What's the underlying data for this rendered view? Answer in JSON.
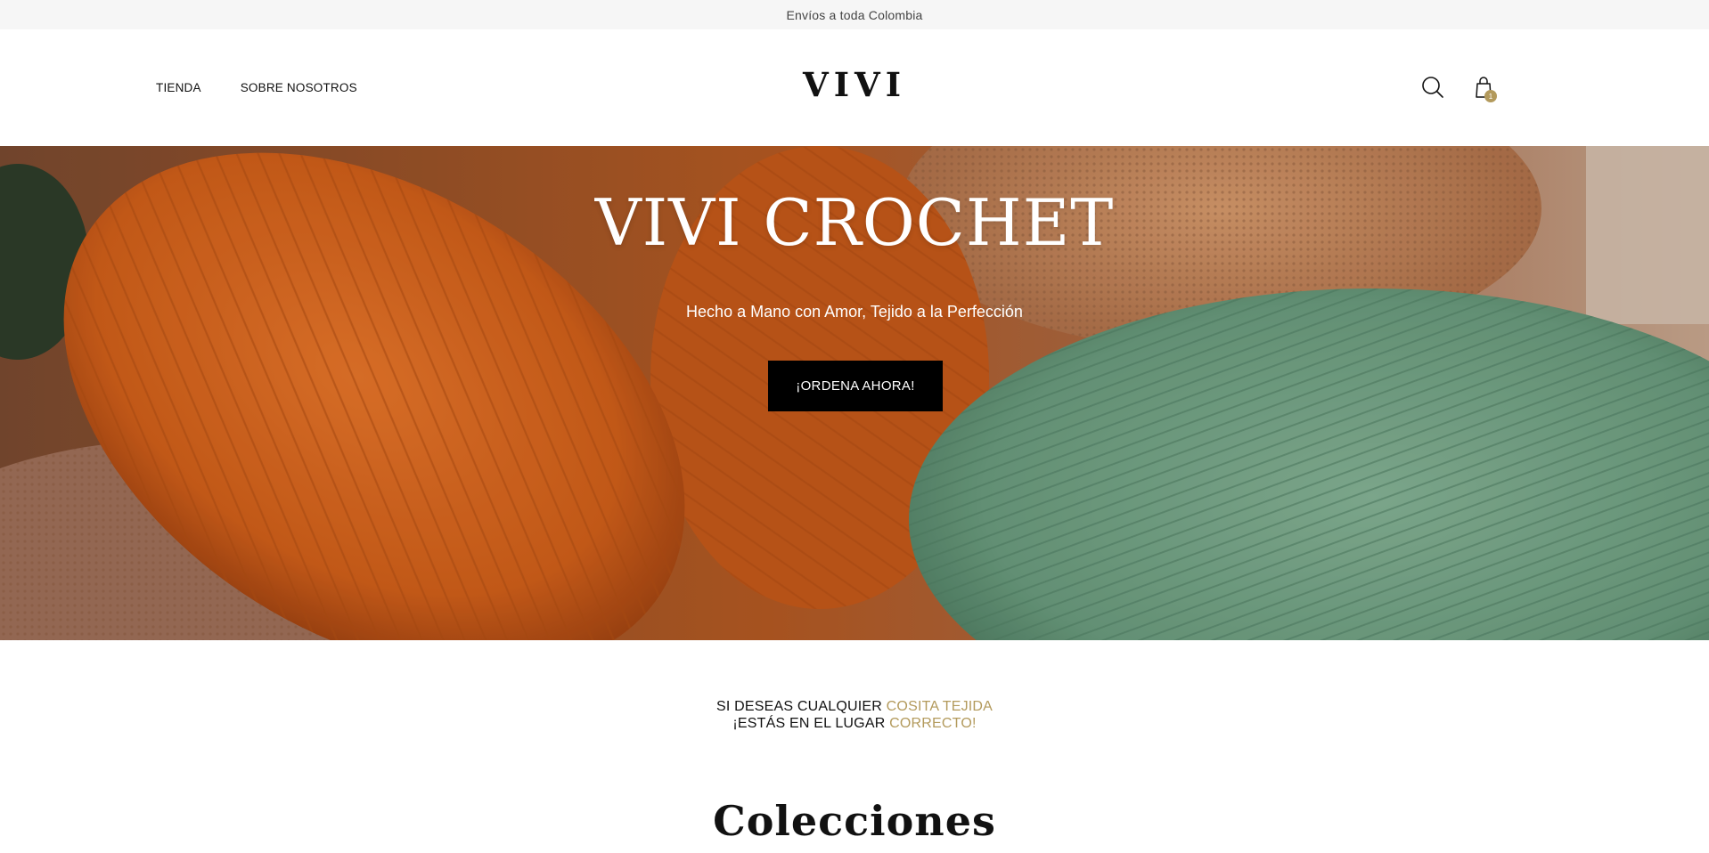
{
  "announcement": {
    "text": "Envíos a toda Colombia"
  },
  "header": {
    "nav": [
      {
        "label": "TIENDA"
      },
      {
        "label": "SOBRE NOSOTROS"
      }
    ],
    "logo": "VIVI",
    "icons": {
      "search": "search-icon",
      "cart": "shopping-bag-icon"
    },
    "cart_count": "1"
  },
  "hero": {
    "title": "VIVI CROCHET",
    "subtitle": "Hecho a Mano con Amor, Tejido a la Perfección",
    "cta_label": "¡ORDENA AHORA!"
  },
  "tagline": {
    "line1_prefix": "SI DESEAS CUALQUIER ",
    "line1_accent": "COSITA TEJIDA",
    "line2_prefix": "¡ESTÁS EN EL LUGAR ",
    "line2_accent": "CORRECTO!"
  },
  "collections": {
    "title": "Colecciones"
  },
  "colors": {
    "accent": "#b39a5c",
    "announcement_bg": "#f6f6f6",
    "cta_bg": "#000000",
    "yarn_orange": "#d9661f",
    "yarn_green": "#6f9f82"
  }
}
